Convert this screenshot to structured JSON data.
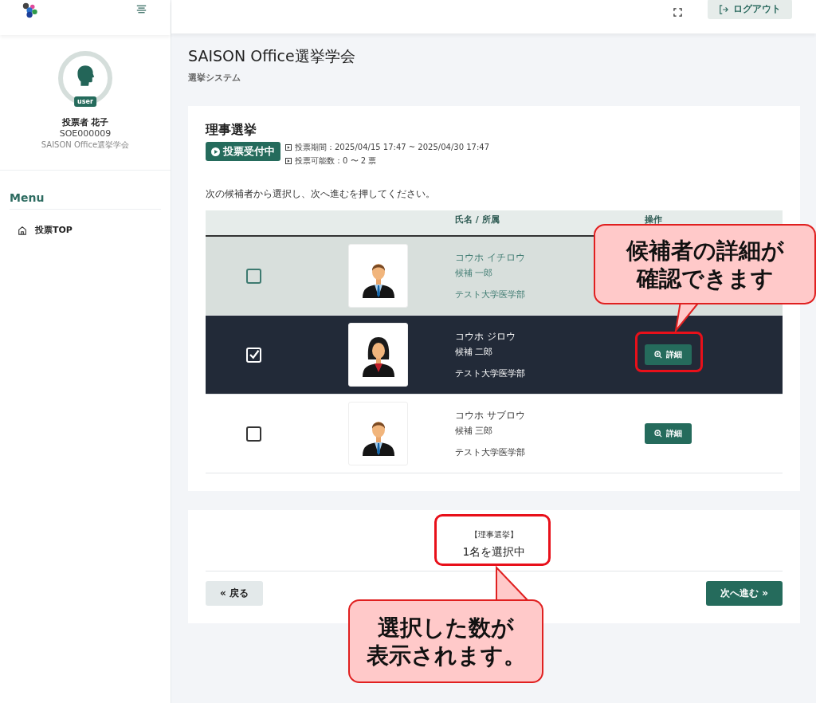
{
  "header": {
    "logout_button": "ログアウト"
  },
  "sidebar": {
    "user": {
      "badge": "user",
      "name": "投票者 花子",
      "id": "SOE000009",
      "organization": "SAISON Office選挙学会"
    },
    "menu_title": "Menu",
    "items": [
      {
        "label": "投票TOP"
      }
    ]
  },
  "page": {
    "title": "SAISON Office選挙学会",
    "subtitle": "選挙システム"
  },
  "election": {
    "title": "理事選挙",
    "status": "投票受付中",
    "period": "投票期間：2025/04/15 17:47 ~ 2025/04/30 17:47",
    "votes": "投票可能数：0 〜 2 票",
    "instruction": "次の候補者から選択し、次へ進むを押してください。"
  },
  "table": {
    "columns": [
      "氏名 / 所属",
      "操作"
    ],
    "rows": [
      {
        "kana": "コウホ イチロウ",
        "name": "候補 一郎",
        "affiliation": "テスト大学医学部",
        "kind": "man",
        "selected": false,
        "hovered": true
      },
      {
        "kana": "コウホ ジロウ",
        "name": "候補 二郎",
        "affiliation": "テスト大学医学部",
        "kind": "woman",
        "selected": true,
        "hovered": false,
        "detail_button": "詳細"
      },
      {
        "kana": "コウホ サブロウ",
        "name": "候補 三郎",
        "affiliation": "テスト大学医学部",
        "kind": "man",
        "selected": false,
        "hovered": false,
        "detail_button": "詳細"
      }
    ]
  },
  "summary": {
    "election": "【理事選挙】",
    "count": "1名を選択中"
  },
  "buttons": {
    "back": "« 戻る",
    "next": "次へ進む »"
  },
  "annotations": [
    {
      "lines": [
        "候補者の詳細が",
        "確認できます"
      ]
    },
    {
      "lines": [
        "選択した数が",
        "表示されます。"
      ]
    }
  ]
}
